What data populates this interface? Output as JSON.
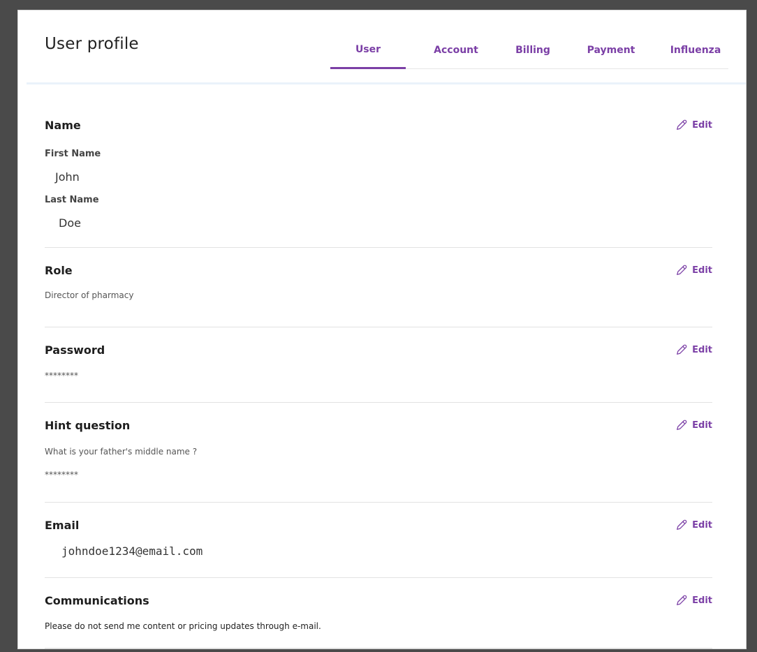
{
  "header": {
    "title": "User profile",
    "tabs": [
      {
        "label": "User",
        "active": true
      },
      {
        "label": "Account",
        "active": false
      },
      {
        "label": "Billing",
        "active": false
      },
      {
        "label": "Payment",
        "active": false
      },
      {
        "label": "Influenza",
        "active": false
      }
    ]
  },
  "accent_color": "#7b3fa6",
  "edit_label": "Edit",
  "sections": {
    "name": {
      "title": "Name",
      "first_name_label": "First Name",
      "first_name_value": "John",
      "last_name_label": "Last Name",
      "last_name_value": "Doe"
    },
    "role": {
      "title": "Role",
      "value": "Director of pharmacy"
    },
    "password": {
      "title": "Password",
      "value": "********"
    },
    "hint": {
      "title": "Hint question",
      "question": "What is your father's middle name ?",
      "answer": "********"
    },
    "email": {
      "title": "Email",
      "value": "johndoe1234@email.com"
    },
    "communications": {
      "title": "Communications",
      "value": "Please do not send me content or pricing updates through e-mail."
    }
  }
}
